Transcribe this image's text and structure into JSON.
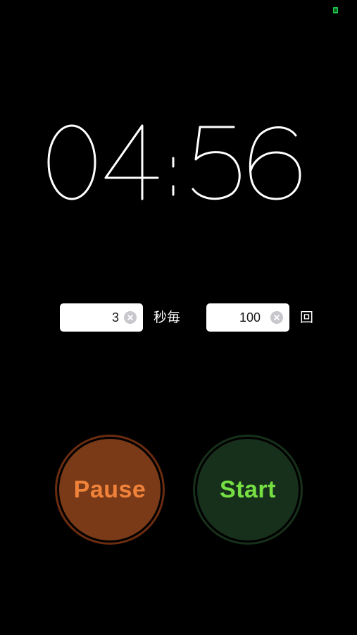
{
  "status_bar": {
    "indicator_icon": "green-status-indicator",
    "indicator_color": "#1ec84a"
  },
  "timer": {
    "display": "04:56",
    "minutes": "04",
    "seconds": "56"
  },
  "interval": {
    "value": "3",
    "unit_label": "秒毎"
  },
  "count": {
    "value": "100",
    "unit_label": "回"
  },
  "buttons": {
    "pause_label": "Pause",
    "start_label": "Start",
    "pause_color": "#f0823a",
    "start_color": "#76e043"
  }
}
